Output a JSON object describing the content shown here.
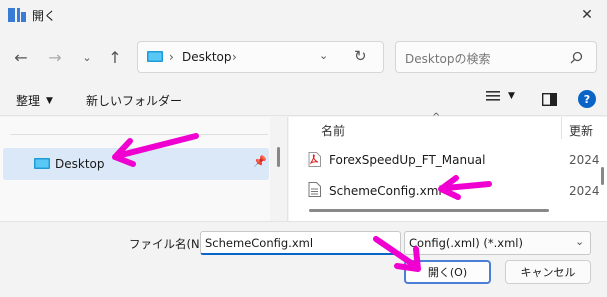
{
  "window": {
    "title": "開く"
  },
  "nav": {
    "address_location": "Desktop",
    "search_placeholder": "Desktopの検索"
  },
  "toolbar": {
    "organize_label": "整理",
    "new_folder_label": "新しいフォルダー"
  },
  "sidebar": {
    "items": [
      {
        "label": "Desktop",
        "selected": true,
        "icon": "desktop-folder-icon"
      }
    ]
  },
  "file_list": {
    "columns": [
      {
        "label": "名前"
      },
      {
        "label": "更新"
      }
    ],
    "rows": [
      {
        "name": "ForexSpeedUp_FT_Manual",
        "date": "2024",
        "icon": "pdf-file-icon"
      },
      {
        "name": "SchemeConfig.xml",
        "date": "2024",
        "icon": "xml-file-icon"
      }
    ]
  },
  "bottom": {
    "filename_label": "ファイル名(N):",
    "filename_value": "SchemeConfig.xml",
    "filetype_value": "Config(.xml) (*.xml)",
    "open_label": "開く(O)",
    "cancel_label": "キャンセル"
  },
  "colors": {
    "accent": "#0a64c8",
    "annotation": "#f000d0",
    "selection": "#dbe8f7"
  }
}
